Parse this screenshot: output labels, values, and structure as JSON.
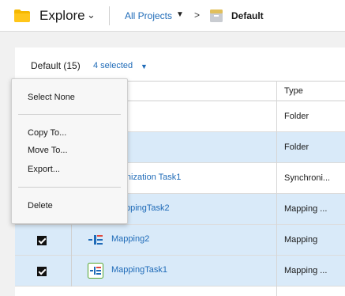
{
  "header": {
    "app_title": "Explore",
    "app_icon": "folder-icon",
    "breadcrumb_link": "All Projects",
    "breadcrumb_separator": ">",
    "breadcrumb_current": "Default",
    "colors": {
      "accent": "#1f6bb8",
      "folder": "#f5b800"
    }
  },
  "toolbar": {
    "count_label": "Default (15)",
    "selected_label": "4 selected"
  },
  "table": {
    "columns": [
      "",
      "Type"
    ],
    "rows": [
      {
        "name": "",
        "type": "Folder",
        "selected": false,
        "checked": false
      },
      {
        "name": "",
        "type": "Folder",
        "selected": true,
        "checked": false
      },
      {
        "name": "hronization Task1",
        "type": "Synchroni...",
        "selected": false,
        "checked": false
      },
      {
        "name": "ppingTask2",
        "type": "Mapping ...",
        "selected": true,
        "checked": false
      },
      {
        "name": "Mapping2",
        "type": "Mapping",
        "selected": true,
        "checked": true,
        "icon": "mapping-icon"
      },
      {
        "name": "MappingTask1",
        "type": "Mapping ...",
        "selected": true,
        "checked": true,
        "icon": "mapping-task-icon"
      }
    ]
  },
  "menu": {
    "select_none": "Select None",
    "copy_to": "Copy To...",
    "move_to": "Move To...",
    "export": "Export...",
    "delete": "Delete"
  }
}
